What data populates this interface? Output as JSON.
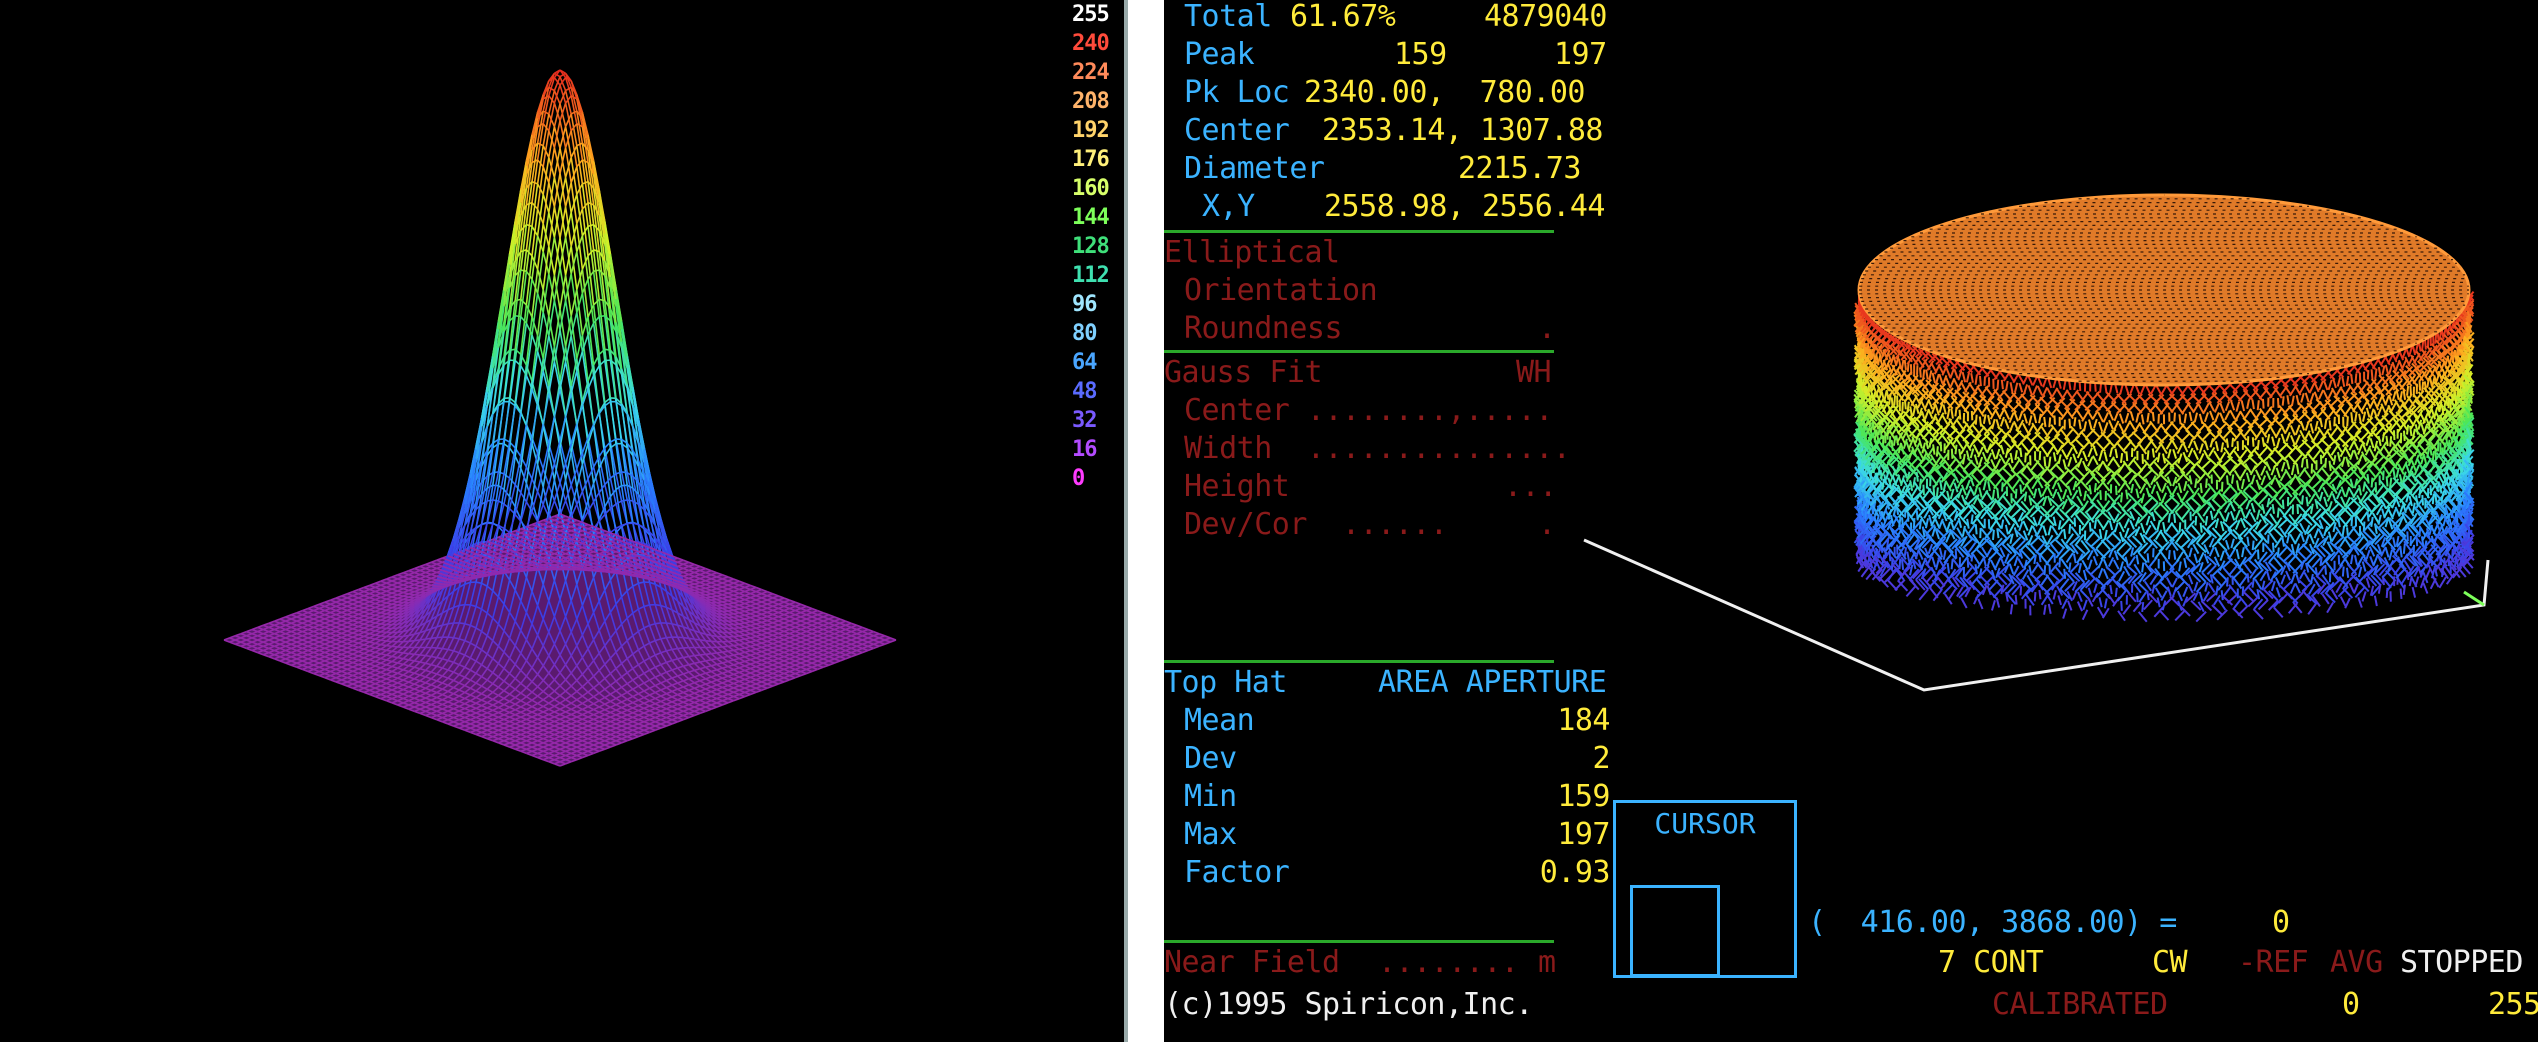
{
  "colors": {
    "blue": "#3bb3ff",
    "yellow": "#ffeb3b",
    "red": "#8a1a1a",
    "green": "#2aa82a",
    "white": "#f0f0f0"
  },
  "scale": {
    "labels": [
      "255",
      "240",
      "224",
      "208",
      "192",
      "176",
      "160",
      "144",
      "128",
      "112",
      "96",
      "80",
      "64",
      "48",
      "32",
      "16",
      "0"
    ],
    "colors": [
      "#ffffff",
      "#ff4b3b",
      "#ff8a5a",
      "#ffb36a",
      "#ffd36a",
      "#fff07a",
      "#d7ff6a",
      "#7dff5a",
      "#3fe07a",
      "#3fe0b0",
      "#9fe6ff",
      "#7fd0ff",
      "#4aa6ff",
      "#5a6bff",
      "#7a5aff",
      "#b34bff",
      "#ff3bff"
    ]
  },
  "stats": {
    "total_label": "Total",
    "total_pct": "61.67%",
    "total_val": "4879040",
    "peak_label": "Peak",
    "peak_a": "159",
    "peak_b": "197",
    "pkloc_label": "Pk Loc",
    "pkloc_val": "2340.00,  780.00",
    "center_label": "Center",
    "center_val": "2353.14, 1307.88",
    "diameter_label": "Diameter",
    "diameter_val": "2215.73",
    "xy_label": "X,Y",
    "xy_val": "2558.98, 2556.44"
  },
  "elliptical": {
    "title": "Elliptical",
    "orientation": "Orientation",
    "roundness": "Roundness",
    "roundness_dot": "."
  },
  "gauss": {
    "title": "Gauss Fit",
    "right": "WH",
    "center": "Center ........,.....",
    "width": "Width  ...............",
    "height": "Height",
    "height_dots": "...",
    "devcor": "Dev/Cor  ......",
    "devcor_dot": "."
  },
  "tophat": {
    "title": "Top Hat",
    "mode": "AREA APERTURE",
    "rows": [
      {
        "label": "Mean",
        "value": "184"
      },
      {
        "label": "Dev",
        "value": "2"
      },
      {
        "label": "Min",
        "value": "159"
      },
      {
        "label": "Max",
        "value": "197"
      },
      {
        "label": "Factor",
        "value": "0.93"
      }
    ]
  },
  "nearfield": {
    "label": "Near Field",
    "dots": "........",
    "m": "m"
  },
  "copyright": "(c)1995 Spiricon,Inc.",
  "cursor": {
    "label": "CURSOR",
    "readout": "(  416.00, 3868.00) =",
    "readout_val": "0"
  },
  "status": {
    "cont": "7 CONT",
    "cw": "CW",
    "ref": "-REF",
    "avg": "AVG",
    "stopped": "STOPPED",
    "calibrated": "CALIBRATED",
    "min": "0",
    "max": "255"
  }
}
